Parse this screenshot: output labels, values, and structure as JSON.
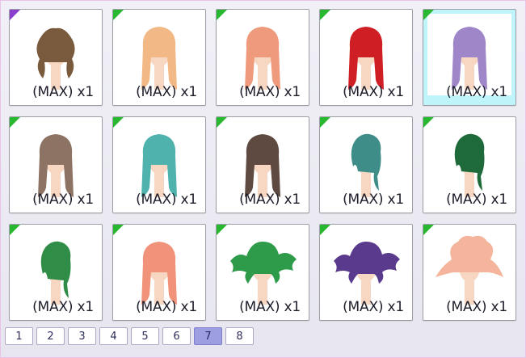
{
  "items": [
    {
      "label": "(MAX) x1",
      "hair": "#7a5a3c",
      "style": "bun",
      "badge": "#8a3ecf",
      "selected": false
    },
    {
      "label": "(MAX) x1",
      "hair": "#f2b987",
      "style": "long",
      "badge": "#27b830",
      "selected": false
    },
    {
      "label": "(MAX) x1",
      "hair": "#ef9a7c",
      "style": "long",
      "badge": "#27b830",
      "selected": false
    },
    {
      "label": "(MAX) x1",
      "hair": "#cf1f25",
      "style": "long",
      "badge": "#27b830",
      "selected": false
    },
    {
      "label": "(MAX) x1",
      "hair": "#9e86c9",
      "style": "long",
      "badge": "#27b830",
      "selected": true
    },
    {
      "label": "(MAX) x1",
      "hair": "#8d7363",
      "style": "long",
      "badge": "#27b830",
      "selected": false
    },
    {
      "label": "(MAX) x1",
      "hair": "#4fb2ad",
      "style": "long",
      "badge": "#27b830",
      "selected": false
    },
    {
      "label": "(MAX) x1",
      "hair": "#5e4a40",
      "style": "long",
      "badge": "#27b830",
      "selected": false
    },
    {
      "label": "(MAX) x1",
      "hair": "#3f8d88",
      "style": "short",
      "badge": "#27b830",
      "selected": false
    },
    {
      "label": "(MAX) x1",
      "hair": "#1f6a3a",
      "style": "short",
      "badge": "#27b830",
      "selected": false
    },
    {
      "label": "(MAX) x1",
      "hair": "#2f8d48",
      "style": "short",
      "badge": "#27b830",
      "selected": false
    },
    {
      "label": "(MAX) x1",
      "hair": "#f0937a",
      "style": "long",
      "badge": "#27b830",
      "selected": false
    },
    {
      "label": "(MAX) x1",
      "hair": "#2e9b4a",
      "style": "wavy",
      "badge": "#27b830",
      "selected": false
    },
    {
      "label": "(MAX) x1",
      "hair": "#5a3a8c",
      "style": "wavy",
      "badge": "#27b830",
      "selected": false
    },
    {
      "label": "(MAX) x1",
      "hair": "#f4b59c",
      "style": "curly",
      "badge": "#27b830",
      "selected": false
    }
  ],
  "pagination": {
    "pages": [
      "1",
      "2",
      "3",
      "4",
      "5",
      "6",
      "7",
      "8"
    ],
    "current": "7"
  },
  "colors": {
    "skin": "#f7d6c2",
    "badge_new": "#27b830",
    "badge_special": "#8a3ecf",
    "selected_bg": "#bff4fa",
    "page_active": "#9d9de2"
  }
}
